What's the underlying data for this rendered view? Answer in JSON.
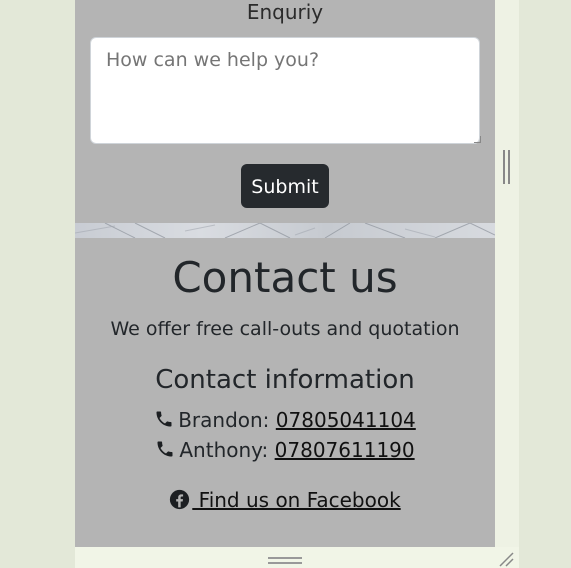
{
  "form": {
    "enquiry_label": "Enquriy",
    "textarea_placeholder": "How can we help you?",
    "submit_label": "Submit"
  },
  "contact": {
    "heading": "Contact us",
    "offer_text": "We offer free call-outs and quotation",
    "info_heading": "Contact information",
    "phones": [
      {
        "name_label": "Brandon:",
        "number": "07805041104",
        "icon": "phone-icon"
      },
      {
        "name_label": "Anthony:",
        "number": "07807611190",
        "icon": "phone-icon"
      }
    ],
    "facebook": {
      "label": " Find us on Facebook",
      "icon": "facebook-icon"
    }
  },
  "colors": {
    "page_bg": "#e3e8d8",
    "panel_bg": "#b4b4b4",
    "button_bg": "#262a2e",
    "text": "#22262a"
  }
}
